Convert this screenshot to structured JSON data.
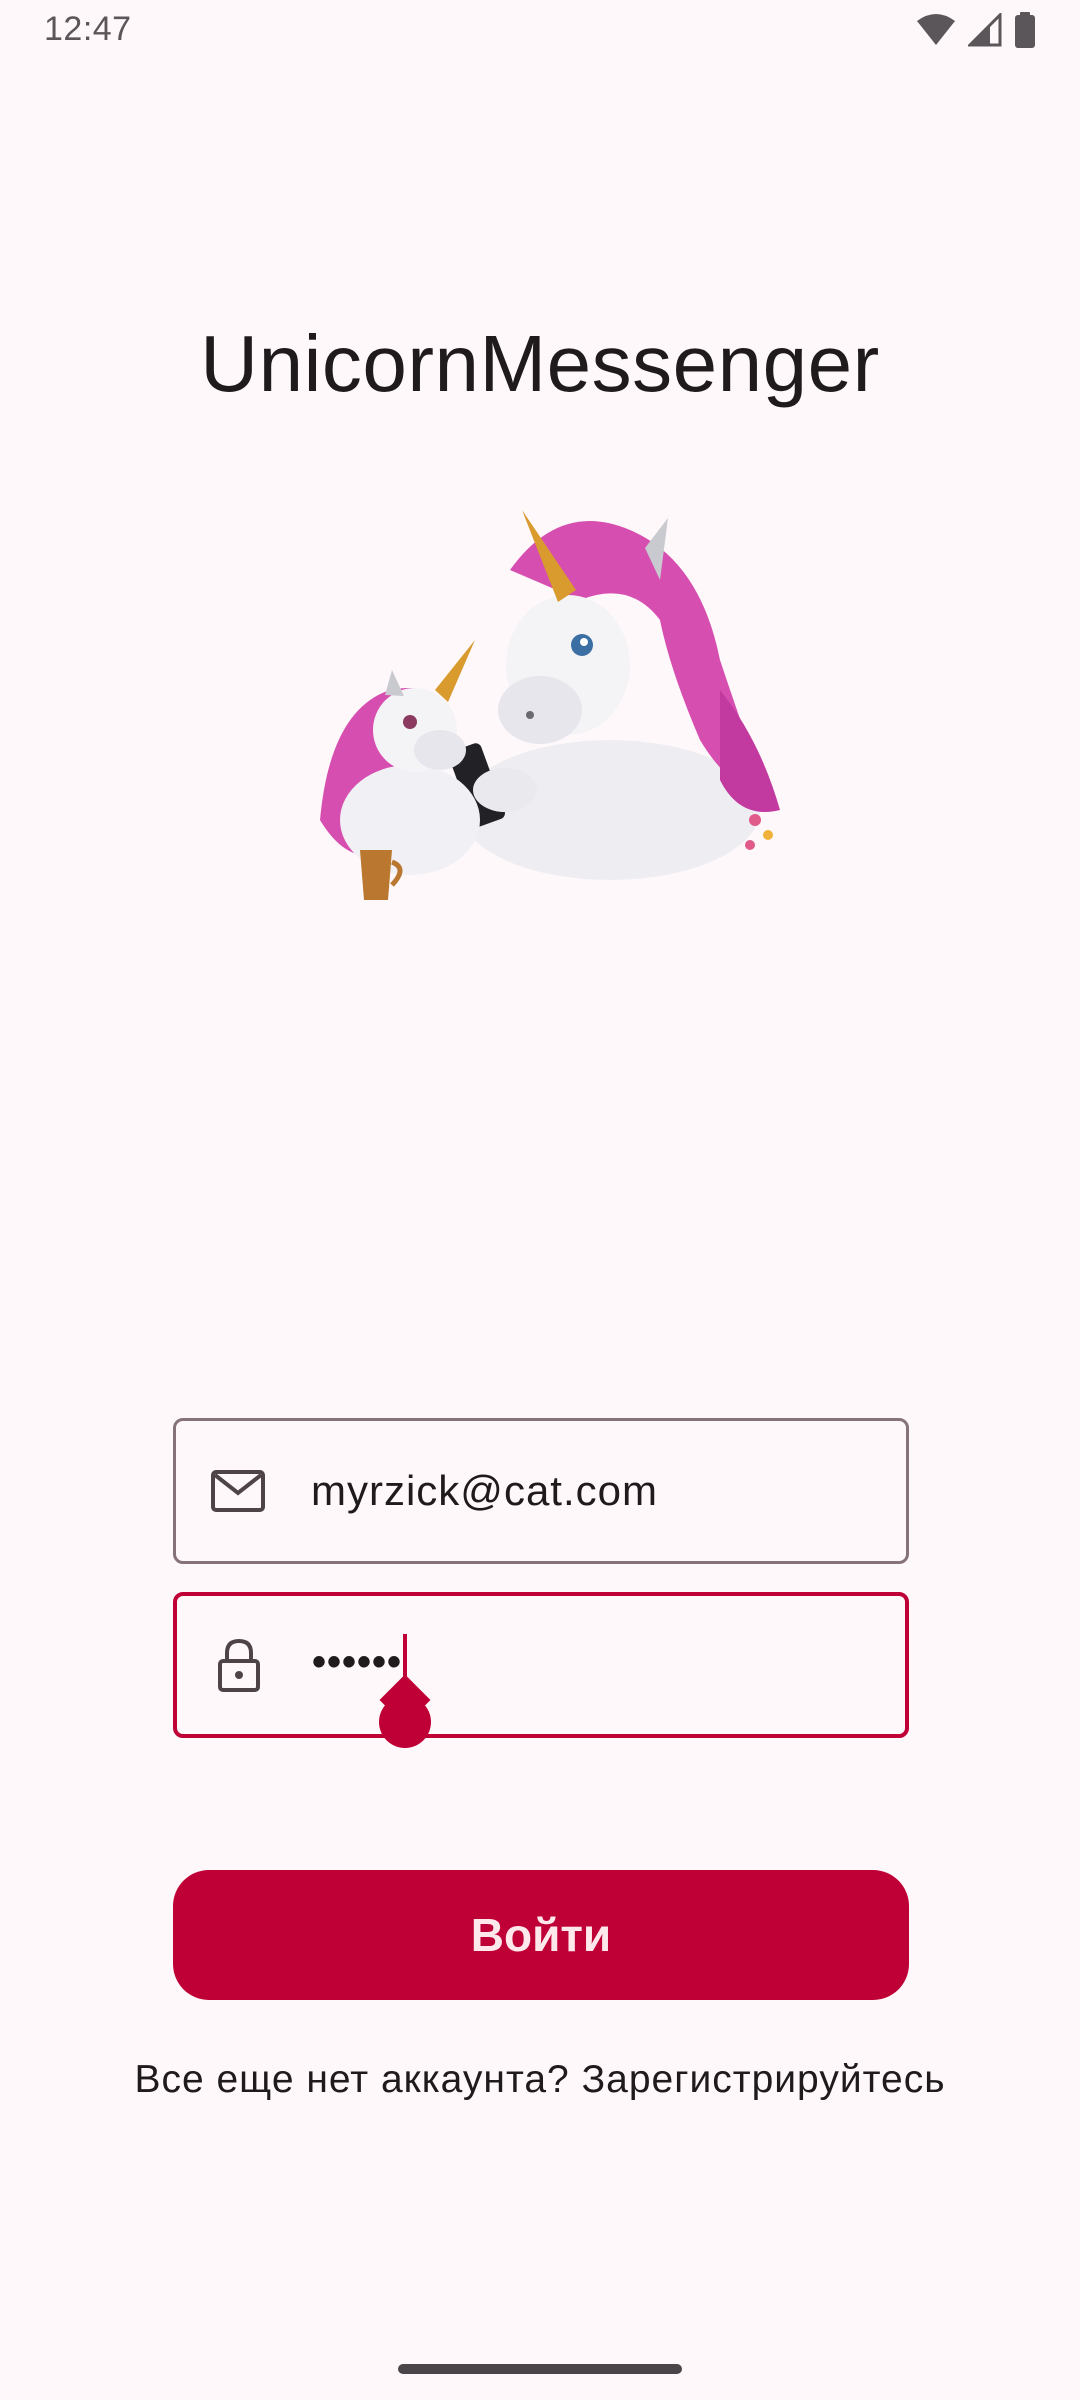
{
  "status_bar": {
    "time": "12:47",
    "icons": [
      "wifi-icon",
      "signal-icon",
      "battery-icon"
    ]
  },
  "app": {
    "title": "UnicornMessenger"
  },
  "illustration": {
    "icon": "unicorn-illustration"
  },
  "login_form": {
    "email": {
      "icon": "mail-icon",
      "value": "myrzick@cat.com"
    },
    "password": {
      "icon": "lock-icon",
      "masked_value": "••••••"
    },
    "submit_label": "Войти",
    "register_prompt": "Все еще нет аккаунта? Зарегистрируйтесь"
  },
  "colors": {
    "primary": "#bf0036",
    "background": "#fff8fb",
    "outline": "#857378",
    "text": "#1f1b1c"
  }
}
